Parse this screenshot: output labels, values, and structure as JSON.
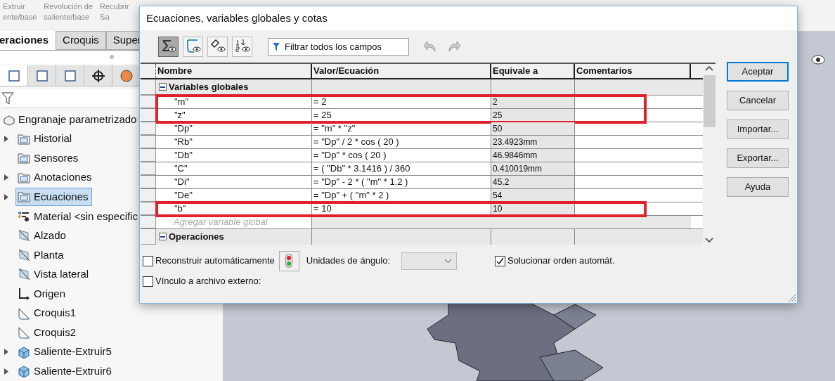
{
  "ribbon": {
    "items": [
      {
        "lines": [
          "Extruir",
          "ente/base"
        ]
      },
      {
        "lines": [
          "Revolución de",
          "saliente/base"
        ]
      },
      {
        "lines": [
          "Recubrir",
          "Sa"
        ]
      }
    ]
  },
  "tabs": [
    {
      "label": "eraciones",
      "selected": true
    },
    {
      "label": "Croquis",
      "selected": false
    },
    {
      "label": "Super",
      "selected": false
    }
  ],
  "tree": {
    "root": "Engranaje parametrizado",
    "items": [
      {
        "label": "Historial",
        "kind": "folder",
        "expandable": true,
        "selected": false
      },
      {
        "label": "Sensores",
        "kind": "folder",
        "expandable": false,
        "selected": false
      },
      {
        "label": "Anotaciones",
        "kind": "folder",
        "expandable": true,
        "selected": false
      },
      {
        "label": "Ecuaciones",
        "kind": "folder",
        "expandable": true,
        "selected": true
      },
      {
        "label": "Material <sin especific",
        "kind": "material",
        "expandable": false,
        "selected": false
      },
      {
        "label": "Alzado",
        "kind": "plane",
        "expandable": false,
        "selected": false
      },
      {
        "label": "Planta",
        "kind": "plane",
        "expandable": false,
        "selected": false
      },
      {
        "label": "Vista lateral",
        "kind": "plane",
        "expandable": false,
        "selected": false
      },
      {
        "label": "Origen",
        "kind": "origin",
        "expandable": false,
        "selected": false
      },
      {
        "label": "Croquis1",
        "kind": "sketch",
        "expandable": false,
        "selected": false
      },
      {
        "label": "Croquis2",
        "kind": "sketch",
        "expandable": false,
        "selected": false
      },
      {
        "label": "Saliente-Extruir5",
        "kind": "feature",
        "expandable": true,
        "selected": false
      },
      {
        "label": "Saliente-Extruir6",
        "kind": "feature",
        "expandable": true,
        "selected": false
      }
    ]
  },
  "dialog": {
    "title": "Ecuaciones, variables globales y cotas",
    "toolbar": {
      "views": [
        {
          "kind": "equations",
          "selected": true
        },
        {
          "kind": "sketch",
          "selected": false
        },
        {
          "kind": "dimensions",
          "selected": false
        },
        {
          "kind": "order",
          "selected": false
        }
      ],
      "filter_placeholder": "Filtrar todos los campos"
    },
    "table": {
      "columns": [
        "Nombre",
        "Valor/Ecuación",
        "Equivale a",
        "Comentarios"
      ],
      "rows": [
        {
          "kind": "group",
          "name": "Variables globales",
          "expanded": true
        },
        {
          "kind": "variable",
          "name": "\"m\"",
          "value": "= 2",
          "result": "2",
          "highlighted": true
        },
        {
          "kind": "variable",
          "name": "\"z\"",
          "value": "= 25",
          "result": "25",
          "highlighted": true
        },
        {
          "kind": "variable",
          "name": "\"Dp\"",
          "value": "= \"m\" * \"z\"",
          "result": "50",
          "highlighted": false
        },
        {
          "kind": "variable",
          "name": "\"Rb\"",
          "value": "= \"Dp\" / 2 * cos ( 20 )",
          "result": "23.4923mm",
          "highlighted": false
        },
        {
          "kind": "variable",
          "name": "\"Db\"",
          "value": "= \"Dp\" * cos ( 20 )",
          "result": "46.9846mm",
          "highlighted": false
        },
        {
          "kind": "variable",
          "name": "\"C\"",
          "value": "= ( \"Db\" * 3.1416 ) / 360",
          "result": "0.410019mm",
          "highlighted": false
        },
        {
          "kind": "variable",
          "name": "\"Di\"",
          "value": "= \"Dp\" - 2 * ( \"m\" * 1.2 )",
          "result": "45.2",
          "highlighted": false
        },
        {
          "kind": "variable",
          "name": "\"De\"",
          "value": "= \"Dp\" + ( \"m\" * 2 )",
          "result": "54",
          "highlighted": false
        },
        {
          "kind": "variable",
          "name": "\"b\"",
          "value": "= 10",
          "result": "10",
          "highlighted": true
        },
        {
          "kind": "add",
          "name": "Agregar variable global"
        },
        {
          "kind": "group",
          "name": "Operaciones",
          "expanded": true
        }
      ]
    },
    "options": {
      "rebuild": {
        "label": "Reconstruir automáticamente",
        "checked": false
      },
      "angle_units_label": "Unidades de ángulo:",
      "solve_order": {
        "label": "Solucionar orden automát.",
        "checked": true
      },
      "external_link": {
        "label": "Vínculo a archivo externo:",
        "checked": false
      }
    },
    "buttons": [
      {
        "label": "Aceptar",
        "default": true
      },
      {
        "label": "Cancelar",
        "default": false
      },
      {
        "label": "Importar...",
        "default": false
      },
      {
        "label": "Exportar...",
        "default": false
      },
      {
        "label": "Ayuda",
        "default": false
      }
    ]
  }
}
